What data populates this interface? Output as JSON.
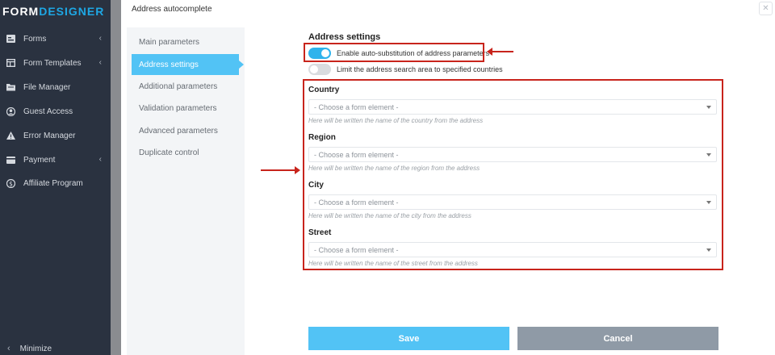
{
  "sidebar": {
    "logo_part1": "FORM",
    "logo_part2": "DESIGNER",
    "items": [
      {
        "label": "Forms",
        "icon": "forms-icon",
        "has_chevron": true
      },
      {
        "label": "Form Templates",
        "icon": "templates-icon",
        "has_chevron": true
      },
      {
        "label": "File Manager",
        "icon": "folder-icon",
        "has_chevron": false
      },
      {
        "label": "Guest Access",
        "icon": "user-icon",
        "has_chevron": false
      },
      {
        "label": "Error Manager",
        "icon": "warning-icon",
        "has_chevron": false
      },
      {
        "label": "Payment",
        "icon": "card-icon",
        "has_chevron": true
      },
      {
        "label": "Affiliate Program",
        "icon": "dollar-icon",
        "has_chevron": false
      }
    ],
    "minimize_label": "Minimize"
  },
  "modal": {
    "title": "Address autocomplete",
    "close_glyph": "✕",
    "tabs": [
      {
        "label": "Main parameters",
        "active": false
      },
      {
        "label": "Address settings",
        "active": true
      },
      {
        "label": "Additional parameters",
        "active": false
      },
      {
        "label": "Validation parameters",
        "active": false
      },
      {
        "label": "Advanced parameters",
        "active": false
      },
      {
        "label": "Duplicate control",
        "active": false
      }
    ],
    "section_title": "Address settings",
    "toggles": [
      {
        "label": "Enable auto-substitution of address parameters",
        "on": true
      },
      {
        "label": "Limit the address search area to specified countries",
        "on": false
      }
    ],
    "fields": [
      {
        "label": "Country",
        "placeholder": "- Choose a form element -",
        "hint": "Here will be written the name of the country from the address"
      },
      {
        "label": "Region",
        "placeholder": "- Choose a form element -",
        "hint": "Here will be written the name of the region from the address"
      },
      {
        "label": "City",
        "placeholder": "- Choose a form element -",
        "hint": "Here will be written the name of the city from the address"
      },
      {
        "label": "Street",
        "placeholder": "- Choose a form element -",
        "hint": "Here will be written the name of the street from the address"
      }
    ],
    "save_label": "Save",
    "cancel_label": "Cancel"
  },
  "colors": {
    "sidebar_bg": "#2a3240",
    "accent": "#52c3f5",
    "toggle_on": "#2fb3ec",
    "cancel_bg": "#8f9aa6",
    "annotation_red": "#c8241c"
  }
}
